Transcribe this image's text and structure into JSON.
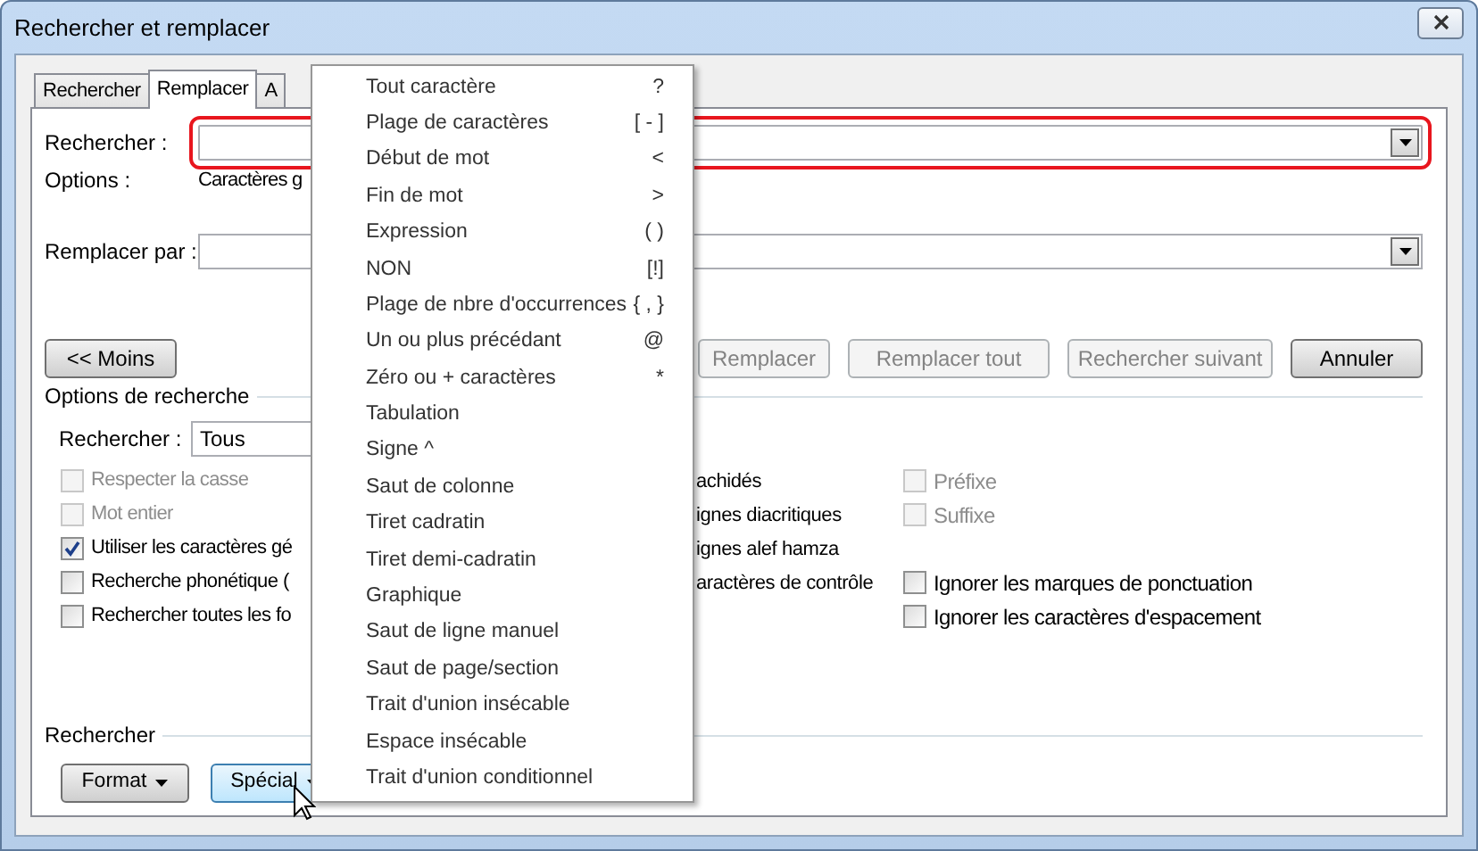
{
  "window": {
    "title": "Rechercher et remplacer"
  },
  "tabs": [
    {
      "label": "Rechercher",
      "selected": false
    },
    {
      "label": "Remplacer",
      "selected": true
    },
    {
      "label": "A",
      "selected": false
    }
  ],
  "find_field": {
    "label": "Rechercher :",
    "highlighted": true
  },
  "options": {
    "label": "Options :",
    "value": "Caractères g"
  },
  "replace_field": {
    "label": "Remplacer par :"
  },
  "less_button": "<< Moins",
  "action_buttons": [
    {
      "label": "Remplacer",
      "disabled": true
    },
    {
      "label": "Remplacer tout",
      "disabled": true
    },
    {
      "label": "Rechercher suivant",
      "disabled": true
    },
    {
      "label": "Annuler",
      "disabled": false
    }
  ],
  "search_options": {
    "title": "Options de recherche",
    "scope": {
      "label": "Rechercher :",
      "value": "Tous"
    },
    "rows": [
      {
        "left": {
          "label": "Respecter la casse",
          "checked": false,
          "disabled": true
        },
        "middle": "achidés",
        "right": {
          "label": "Préfixe",
          "checked": false,
          "disabled": true
        }
      },
      {
        "left": {
          "label": "Mot entier",
          "checked": false,
          "disabled": true
        },
        "middle": "ignes diacritiques",
        "right": {
          "label": "Suffixe",
          "checked": false,
          "disabled": true
        }
      },
      {
        "left": {
          "label": "Utiliser les caractères gé",
          "checked": true,
          "disabled": false
        },
        "middle": "ignes alef hamza"
      },
      {
        "left": {
          "label": "Recherche phonétique (",
          "checked": false,
          "disabled": false
        },
        "middle": "aractères de contrôle",
        "right": {
          "label": "Ignorer les marques de ponctuation",
          "checked": false,
          "disabled": false
        }
      },
      {
        "left": {
          "label": "Rechercher toutes les fo",
          "checked": false,
          "disabled": false
        },
        "right": {
          "label": "Ignorer les caractères d'espacement",
          "checked": false,
          "disabled": false
        }
      }
    ]
  },
  "find_section": {
    "title": "Rechercher",
    "buttons": [
      {
        "label": "Format",
        "focused": false
      },
      {
        "label": "Spécial",
        "focused": true
      }
    ]
  },
  "menu": {
    "items": [
      {
        "label": "Tout caractère",
        "shortcut": "?"
      },
      {
        "label": "Plage de caractères",
        "shortcut": "[ - ]"
      },
      {
        "label": "Début de mot",
        "shortcut": "<"
      },
      {
        "label": "Fin de mot",
        "shortcut": ">"
      },
      {
        "label": "Expression",
        "shortcut": "( )"
      },
      {
        "label": "NON",
        "shortcut": "[!]"
      },
      {
        "label": "Plage de nbre d'occurrences",
        "shortcut": "{ , }"
      },
      {
        "label": "Un ou plus précédant",
        "shortcut": "@"
      },
      {
        "label": "Zéro ou + caractères",
        "shortcut": "*"
      },
      {
        "label": "Tabulation"
      },
      {
        "label": "Signe ^"
      },
      {
        "label": "Saut de colonne"
      },
      {
        "label": "Tiret cadratin"
      },
      {
        "label": "Tiret demi-cadratin"
      },
      {
        "label": "Graphique"
      },
      {
        "label": "Saut de ligne manuel"
      },
      {
        "label": "Saut de page/section"
      },
      {
        "label": "Trait d'union insécable"
      },
      {
        "label": "Espace insécable"
      },
      {
        "label": "Trait d'union conditionnel"
      }
    ]
  }
}
